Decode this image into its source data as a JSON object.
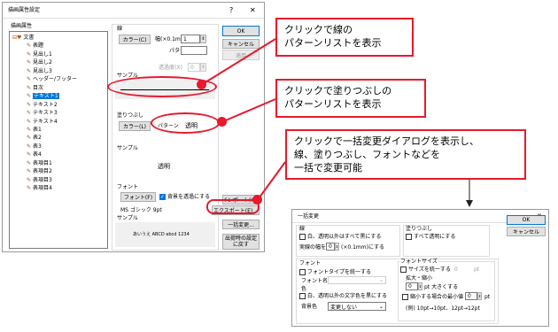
{
  "dialog": {
    "title": "描画属性設定",
    "help": "?",
    "close": "✕",
    "attr_label": "描画属性",
    "tree": [
      {
        "l": "文書",
        "lv": 0
      },
      {
        "l": "表題",
        "lv": 1
      },
      {
        "l": "見出し1",
        "lv": 1
      },
      {
        "l": "見出し2",
        "lv": 1
      },
      {
        "l": "見出し3",
        "lv": 1
      },
      {
        "l": "ヘッダー/フッター",
        "lv": 1
      },
      {
        "l": "目次",
        "lv": 1
      },
      {
        "l": "テキスト1",
        "lv": 1,
        "sel": true
      },
      {
        "l": "テキスト2",
        "lv": 1
      },
      {
        "l": "テキスト3",
        "lv": 1
      },
      {
        "l": "テキスト4",
        "lv": 1
      },
      {
        "l": "表1",
        "lv": 1
      },
      {
        "l": "表2",
        "lv": 1
      },
      {
        "l": "表3",
        "lv": 1
      },
      {
        "l": "表4",
        "lv": 1
      },
      {
        "l": "表項目1",
        "lv": 1
      },
      {
        "l": "表項目2",
        "lv": 1
      },
      {
        "l": "表項目3",
        "lv": 1
      },
      {
        "l": "表項目4",
        "lv": 1
      }
    ],
    "line_group": "線",
    "color_btn": "カラー(C)",
    "width_label": "幅(×0.1mm)",
    "width_value": "1",
    "pattern_label": "パターン",
    "transparency_label": "透過度(X)",
    "transparency_value": "0",
    "sample_label": "サンプル",
    "fill_group": "塗りつぶし",
    "fill_color_btn": "カラー(L)",
    "fill_pattern_label": "パターン",
    "fill_pattern_value": "透明",
    "fill_sample_label": "サンプル",
    "fill_sample_text": "透明",
    "font_group": "フォント",
    "font_btn": "フォント(F)",
    "bg_transparent_label": "背景を透過にする",
    "font_name": "MS ゴシック 9pt",
    "font_sample_label": "サンプル",
    "font_sample_text": "あいうえ ABCD abcd 1234",
    "ok": "OK",
    "cancel": "キャンセル",
    "apply": "適用",
    "import": "インポート(I)...",
    "export": "エクスポート(E)...",
    "bulk": "一括変更...",
    "restore": "出荷時の設定に戻す"
  },
  "callouts": {
    "c1": [
      "クリックで線の",
      "パターンリストを表示"
    ],
    "c2": [
      "クリックで塗りつぶしの",
      "パターンリストを表示"
    ],
    "c3": [
      "クリックで一括変更ダイアログを表示し、",
      "線、塗りつぶし、フォントなどを",
      "一括で変更可能"
    ]
  },
  "bulk_dialog": {
    "title": "一括変更",
    "close": "✕",
    "line_group": "線",
    "line_check": "白、透明以外はすべて黒にする",
    "width_label": "実線の幅を",
    "width_value": "0",
    "width_unit": "(×0.1mm)にする",
    "fill_group": "塗りつぶし",
    "fill_check": "すべて透明にする",
    "ok": "OK",
    "cancel": "キャンセル",
    "font_group": "フォント",
    "font_type_check": "フォントタイプを統一する",
    "font_name_label": "フォント名",
    "color_label": "色",
    "color_check": "白、透明以外の文字色を黒にする",
    "bg_label": "背景色",
    "bg_value": "変更しない",
    "size_group": "フォントサイズ",
    "size_check": "サイズを統一する",
    "size_value": "0",
    "size_unit": "pt",
    "scale_label": "拡大・縮小",
    "scale_value": "0",
    "scale_unit": "pt 大きくする",
    "min_check": "縮小する場合の最小値",
    "min_value": "0",
    "min_unit": "pt",
    "example": "(例) 10pt→10pt、12pt→12pt"
  }
}
